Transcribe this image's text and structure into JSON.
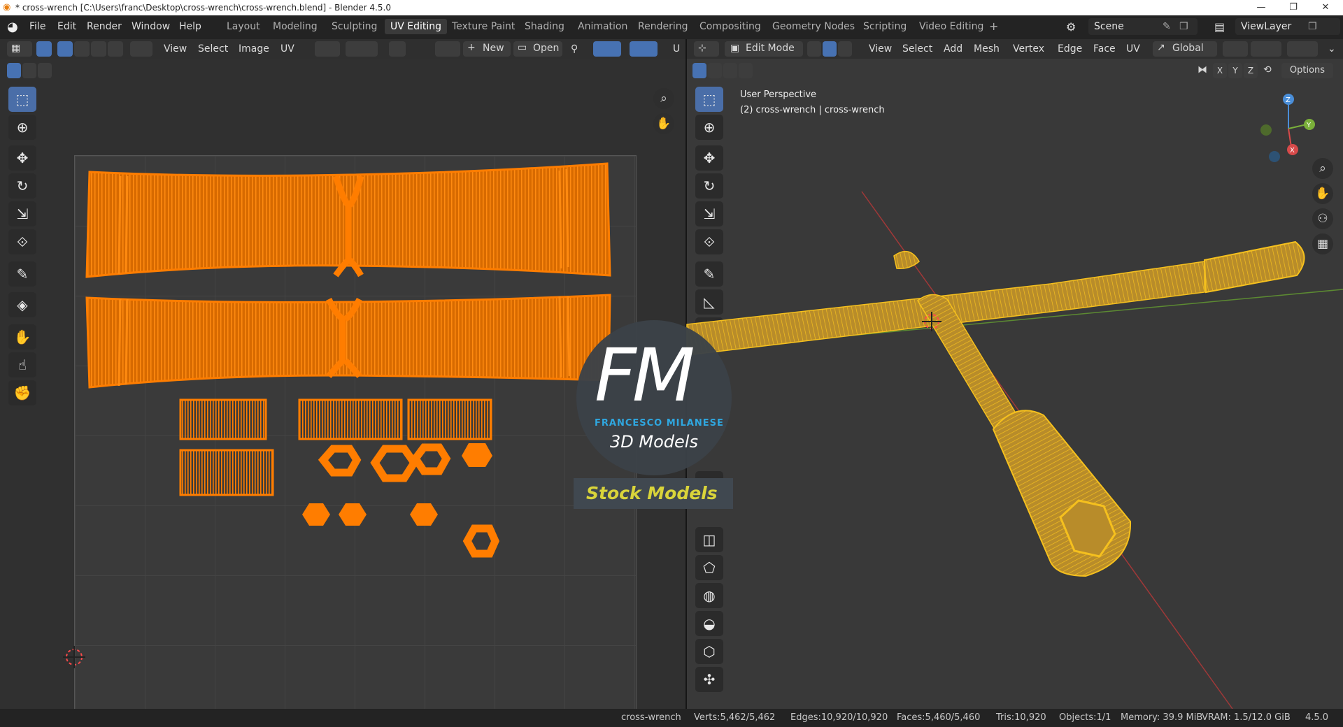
{
  "window": {
    "title": "* cross-wrench [C:\\Users\\franc\\Desktop\\cross-wrench\\cross-wrench.blend] - Blender 4.5.0",
    "minimize": "—",
    "restore": "❐",
    "close": "✕"
  },
  "menu": [
    "File",
    "Edit",
    "Render",
    "Window",
    "Help"
  ],
  "workspaces": {
    "tabs": [
      "Layout",
      "Modeling",
      "Sculpting",
      "UV Editing",
      "Texture Paint",
      "Shading",
      "Animation",
      "Rendering",
      "Compositing",
      "Geometry Nodes",
      "Scripting",
      "Video Editing"
    ],
    "active": "UV Editing",
    "add": "+"
  },
  "scene": {
    "label": "Scene",
    "viewlayer": "ViewLayer"
  },
  "uv_editor": {
    "header": [
      "View",
      "Select",
      "Image",
      "UV"
    ],
    "new_label": "New",
    "open_label": "Open",
    "sync_label": "U"
  },
  "viewport": {
    "mode": "Edit Mode",
    "header": [
      "View",
      "Select",
      "Add",
      "Mesh",
      "Vertex",
      "Edge",
      "Face",
      "UV"
    ],
    "transform_orientation": "Global",
    "axes": [
      "X",
      "Y",
      "Z"
    ],
    "options_label": "Options",
    "overlay_line1": "User Perspective",
    "overlay_line2": "(2) cross-wrench | cross-wrench",
    "gizmo": {
      "x": "X",
      "y": "Y",
      "z": "Z"
    }
  },
  "watermark": {
    "logo": "FM",
    "name": "FRANCESCO MILANESE",
    "sub": "3D Models",
    "banner": "Stock Models"
  },
  "status": {
    "object": "cross-wrench",
    "verts": "Verts:5,462/5,462",
    "edges": "Edges:10,920/10,920",
    "faces": "Faces:5,460/5,460",
    "tris": "Tris:10,920",
    "objects": "Objects:1/1",
    "memory": "Memory: 39.9 MiB",
    "vram": "VRAM: 1.5/12.0 GiB",
    "version": "4.5.0"
  },
  "colors": {
    "accent": "#4772b3",
    "uv_orange": "#ff7d00",
    "mesh_yellow": "#f5c01e",
    "watermark_blue": "#2fa7e0",
    "banner_yellow": "#d9d43a"
  },
  "icons": {
    "uv_tools": [
      "select-box-icon",
      "cursor-icon",
      "move-icon",
      "rotate-icon",
      "scale-icon",
      "transform-icon",
      "annotate-icon",
      "rip-icon",
      "grab-icon",
      "relax-icon",
      "pinch-icon"
    ],
    "viewport_tools": [
      "select-box-icon",
      "cursor-icon",
      "move-icon",
      "rotate-icon",
      "scale-icon",
      "transform-icon",
      "annotate-icon",
      "measure-icon"
    ]
  }
}
